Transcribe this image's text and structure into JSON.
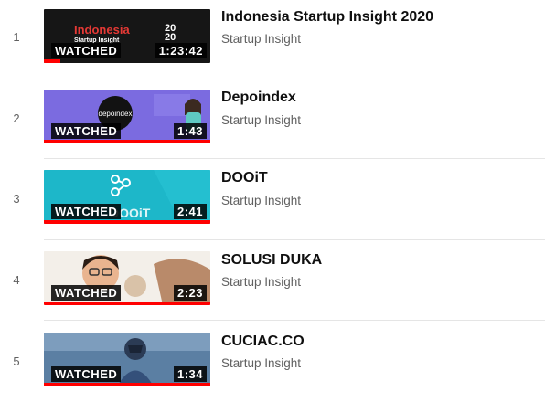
{
  "playlist": {
    "items": [
      {
        "index": "1",
        "title": "Indonesia Startup Insight 2020",
        "channel": "Startup Insight",
        "watched_label": "WATCHED",
        "duration": "1:23:42",
        "progress": 0.1,
        "thumb": {
          "brand": "Indonesia",
          "sub": "Startup Insight",
          "year_top": "20",
          "year_bottom": "20",
          "bg": "#161616",
          "brand_color": "#e53935"
        }
      },
      {
        "index": "2",
        "title": "Depoindex",
        "channel": "Startup Insight",
        "watched_label": "WATCHED",
        "duration": "1:43",
        "progress": 1.0,
        "thumb": {
          "logo": "depoindex",
          "bg": "#7b6be0"
        }
      },
      {
        "index": "3",
        "title": "DOOiT",
        "channel": "Startup Insight",
        "watched_label": "WATCHED",
        "duration": "2:41",
        "progress": 1.0,
        "thumb": {
          "logo": "DOOiT",
          "bg": "#1db7c9"
        }
      },
      {
        "index": "4",
        "title": "SOLUSI DUKA",
        "channel": "Startup Insight",
        "watched_label": "WATCHED",
        "duration": "2:23",
        "progress": 1.0,
        "thumb": {
          "bg": "#f3efe9"
        }
      },
      {
        "index": "5",
        "title": "CUCIAC.CO",
        "channel": "Startup Insight",
        "watched_label": "WATCHED",
        "duration": "1:34",
        "progress": 1.0,
        "thumb": {
          "bg": "#5b7fa3"
        }
      }
    ]
  },
  "colors": {
    "progress": "#ff0000",
    "title": "#0f0f0f",
    "meta": "#606060"
  }
}
